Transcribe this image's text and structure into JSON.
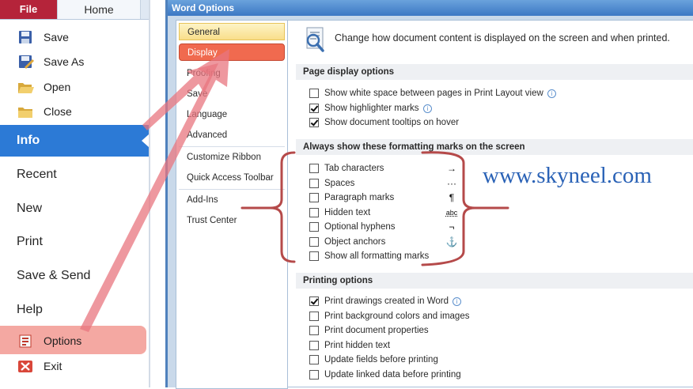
{
  "ribbon": {
    "file_tab": "File",
    "home_tab": "Home"
  },
  "backstage": {
    "commands": [
      {
        "label": "Save",
        "icon": "save-icon"
      },
      {
        "label": "Save As",
        "icon": "save-as-icon"
      },
      {
        "label": "Open",
        "icon": "open-folder-icon"
      },
      {
        "label": "Close",
        "icon": "close-folder-icon"
      }
    ],
    "sections": [
      "Info",
      "Recent",
      "New",
      "Print",
      "Save & Send",
      "Help"
    ],
    "options": {
      "label": "Options",
      "icon": "options-icon"
    },
    "exit": {
      "label": "Exit",
      "icon": "exit-icon"
    }
  },
  "dialog": {
    "title": "Word Options",
    "nav": [
      "General",
      "Display",
      "Proofing",
      "Save",
      "Language",
      "Advanced",
      "Customize Ribbon",
      "Quick Access Toolbar",
      "Add-Ins",
      "Trust Center"
    ],
    "selected_nav": "Display",
    "intro": "Change how document content is displayed on the screen and when printed.",
    "page_display": {
      "header": "Page display options",
      "options": [
        {
          "label": "Show white space between pages in Print Layout view",
          "checked": false,
          "info": true
        },
        {
          "label": "Show highlighter marks",
          "checked": true,
          "info": true
        },
        {
          "label": "Show document tooltips on hover",
          "checked": true,
          "info": false
        }
      ]
    },
    "formatting_marks": {
      "header": "Always show these formatting marks on the screen",
      "options": [
        {
          "label": "Tab characters",
          "checked": false,
          "mark": "→"
        },
        {
          "label": "Spaces",
          "checked": false,
          "mark": "···"
        },
        {
          "label": "Paragraph marks",
          "checked": false,
          "mark": "¶"
        },
        {
          "label": "Hidden text",
          "checked": false,
          "mark": "abc"
        },
        {
          "label": "Optional hyphens",
          "checked": false,
          "mark": "¬"
        },
        {
          "label": "Object anchors",
          "checked": false,
          "mark": "⚓"
        },
        {
          "label": "Show all formatting marks",
          "checked": false,
          "mark": ""
        }
      ]
    },
    "printing": {
      "header": "Printing options",
      "options": [
        {
          "label": "Print drawings created in Word",
          "checked": true,
          "info": true
        },
        {
          "label": "Print background colors and images",
          "checked": false,
          "info": false
        },
        {
          "label": "Print document properties",
          "checked": false,
          "info": false
        },
        {
          "label": "Print hidden text",
          "checked": false,
          "info": false
        },
        {
          "label": "Update fields before printing",
          "checked": false,
          "info": false
        },
        {
          "label": "Update linked data before printing",
          "checked": false,
          "info": false
        }
      ]
    }
  },
  "watermark": "www.skyneel.com",
  "colors": {
    "file_tab": "#b5243a",
    "info_selected": "#2c7ad6",
    "annotation": "#e8757f",
    "brace": "#b54a4a",
    "watermark": "#2a62b6",
    "dialog_title": "#3c78c4"
  }
}
